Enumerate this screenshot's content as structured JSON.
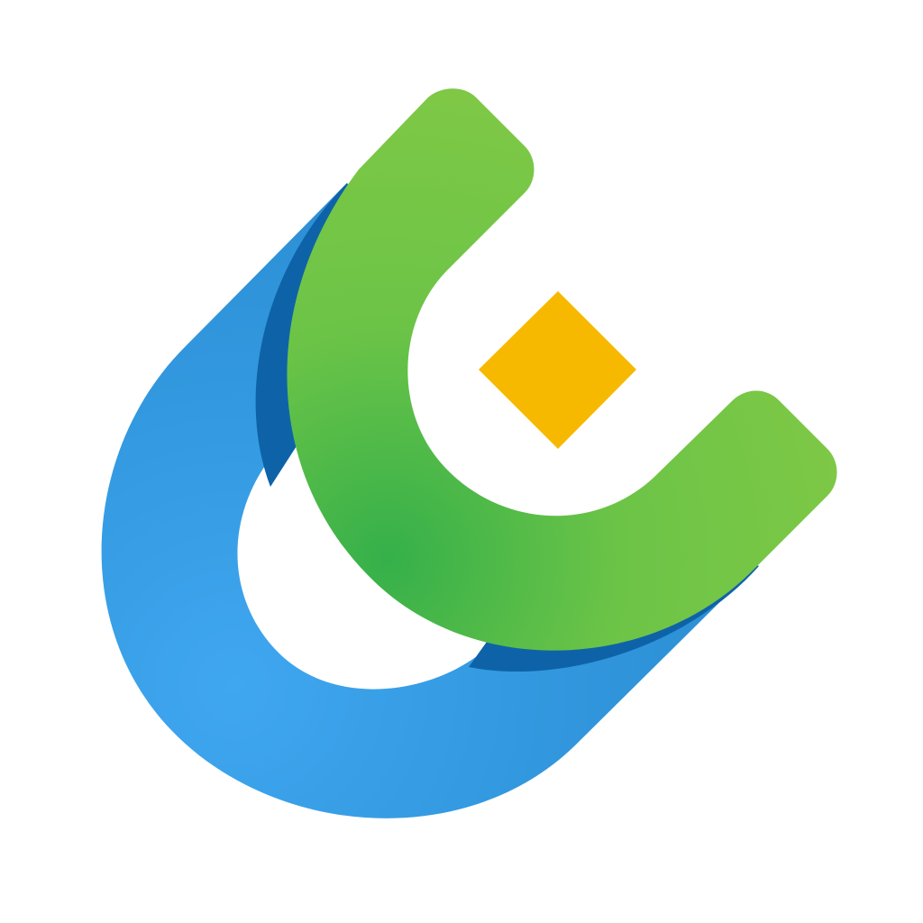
{
  "logo": {
    "icon": "stacked-u-shapes-logo-icon",
    "colors": {
      "background": "#ffffff",
      "blue_light": "#3fa7f0",
      "blue_mid": "#2c8fd4",
      "blue_dark": "#0e63a8",
      "green_light": "#7ec846",
      "green_dark": "#35b04a",
      "diamond": "#f7b900"
    }
  }
}
